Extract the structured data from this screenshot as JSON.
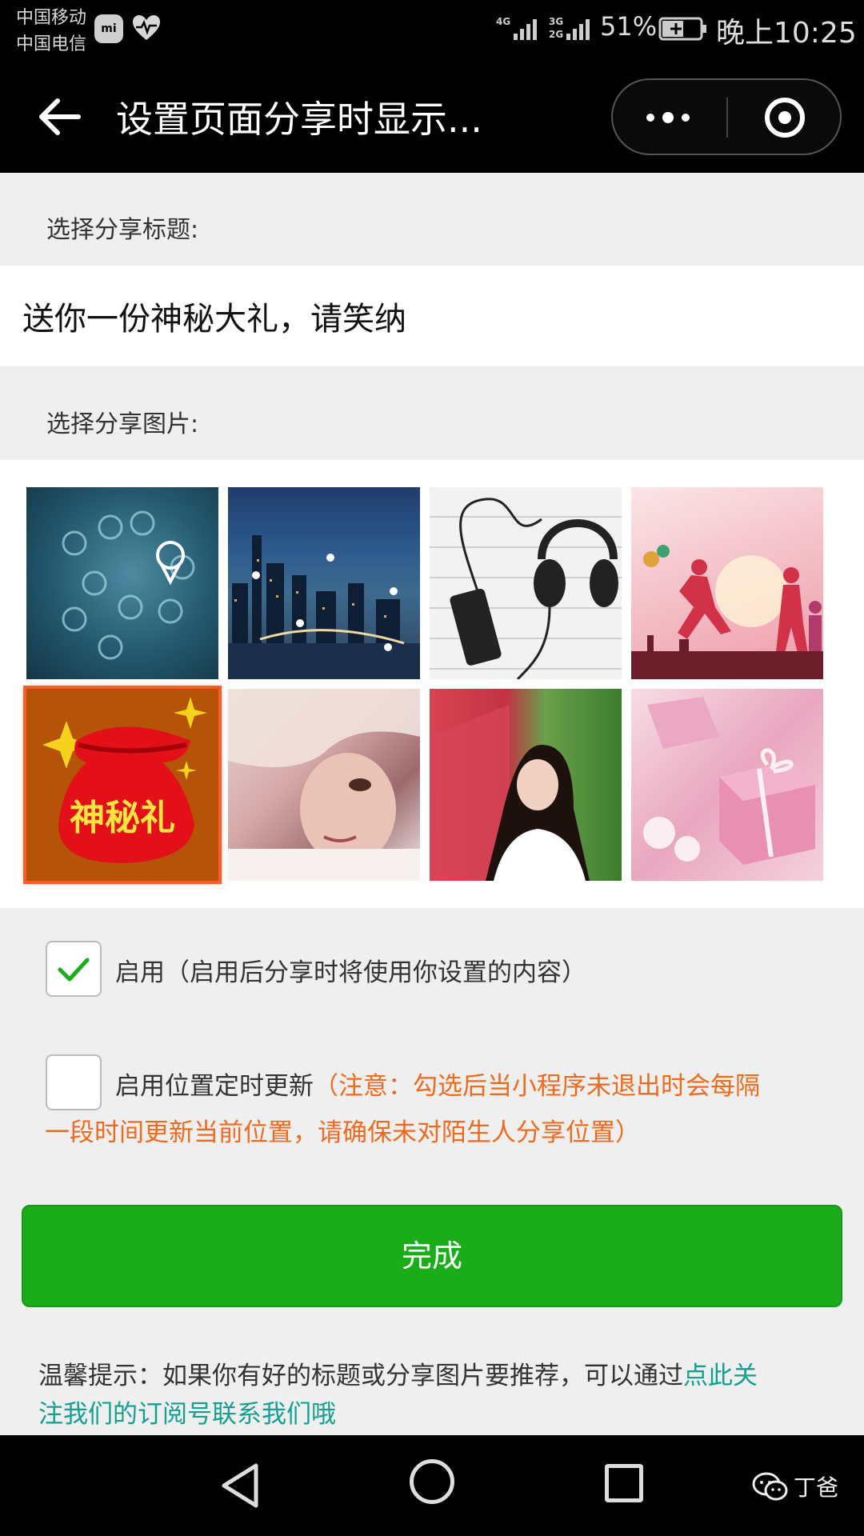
{
  "status_bar": {
    "carrier1": "中国移动",
    "carrier2": "中国电信",
    "mi_badge": "mi",
    "net1_top": "4G",
    "net2_top": "3G",
    "net2_bottom": "2G",
    "battery": "51%",
    "time": "晚上10:25"
  },
  "nav": {
    "title": "设置页面分享时显示...",
    "icons": [
      "back-arrow-icon",
      "more-dots-icon",
      "target-icon"
    ]
  },
  "share_title": {
    "label": "选择分享标题:",
    "value": "送你一份神秘大礼，请笑纳"
  },
  "share_image": {
    "label": "选择分享图片:",
    "images": [
      {
        "desc": "location pins network"
      },
      {
        "desc": "city night map pins"
      },
      {
        "desc": "headphones and phone"
      },
      {
        "desc": "runners silhouette"
      },
      {
        "desc": "mystery gift bag",
        "text": "神秘礼",
        "selected": true
      },
      {
        "desc": "woman face"
      },
      {
        "desc": "girl portrait"
      },
      {
        "desc": "pink gift boxes"
      }
    ]
  },
  "options": {
    "enable": {
      "label": "启用（启用后分享时将使用你设置的内容）",
      "checked": true
    },
    "location_update": {
      "label": "启用位置定时更新",
      "warning_line1": "（注意：勾选后当小程序未退出时会每隔",
      "warning_line2": "一段时间更新当前位置，请确保未对陌生人分享位置）",
      "checked": false
    }
  },
  "done_button": "完成",
  "tip": {
    "prefix": "温馨提示：如果你有好的标题或分享图片要推荐，可以通过",
    "link_part1": "点此关",
    "link_part2": "注我们的订阅号联系我们哦"
  },
  "watermark": "丁爸",
  "colors": {
    "accent_green": "#1aad19",
    "warning_orange": "#f06a1d",
    "link_teal": "#12a08f",
    "selected_outline": "#ff5a2a"
  }
}
